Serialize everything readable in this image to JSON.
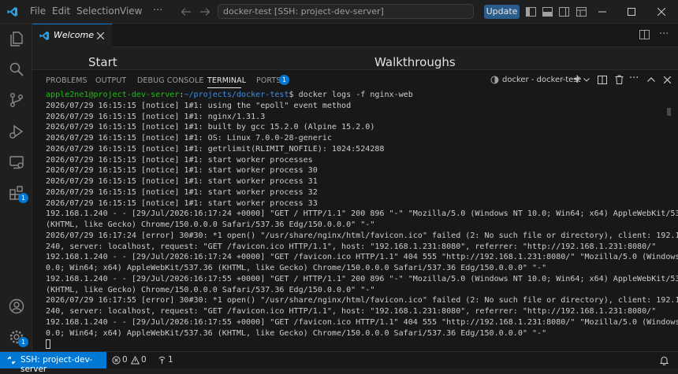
{
  "titlebar": {
    "menu": [
      "File",
      "Edit",
      "Selection",
      "View"
    ],
    "command_center": "docker-test [SSH: project-dev-server]",
    "update_label": "Update"
  },
  "activity": {
    "extensions_badge": "1",
    "settings_badge": "1"
  },
  "editor": {
    "tab_label": "Welcome",
    "start_heading": "Start",
    "walkthroughs_heading": "Walkthroughs"
  },
  "panel": {
    "tabs": [
      "PROBLEMS",
      "OUTPUT",
      "DEBUG CONSOLE",
      "TERMINAL",
      "PORTS"
    ],
    "ports_badge": "1",
    "terminal_name": "docker - docker-test"
  },
  "terminal": {
    "prompt_user": "apple2ne1@project-dev-server",
    "prompt_sep": ":",
    "prompt_path": "~/projects/docker-test",
    "prompt_cmd": "$ docker logs -f nginx-web",
    "lines": [
      "2026/07/29 16:15:15 [notice] 1#1: using the \"epoll\" event method",
      "2026/07/29 16:15:15 [notice] 1#1: nginx/1.31.3",
      "2026/07/29 16:15:15 [notice] 1#1: built by gcc 15.2.0 (Alpine 15.2.0)",
      "2026/07/29 16:15:15 [notice] 1#1: OS: Linux 7.0.0-28-generic",
      "2026/07/29 16:15:15 [notice] 1#1: getrlimit(RLIMIT_NOFILE): 1024:524288",
      "2026/07/29 16:15:15 [notice] 1#1: start worker processes",
      "2026/07/29 16:15:15 [notice] 1#1: start worker process 30",
      "2026/07/29 16:15:15 [notice] 1#1: start worker process 31",
      "2026/07/29 16:15:15 [notice] 1#1: start worker process 32",
      "2026/07/29 16:15:15 [notice] 1#1: start worker process 33",
      "192.168.1.240 - - [29/Jul/2026:16:17:24 +0000] \"GET / HTTP/1.1\" 200 896 \"-\" \"Mozilla/5.0 (Windows NT 10.0; Win64; x64) AppleWebKit/537.36",
      "(KHTML, like Gecko) Chrome/150.0.0.0 Safari/537.36 Edg/150.0.0.0\" \"-\"",
      "2026/07/29 16:17:24 [error] 30#30: *1 open() \"/usr/share/nginx/html/favicon.ico\" failed (2: No such file or directory), client: 192.168.1.",
      "240, server: localhost, request: \"GET /favicon.ico HTTP/1.1\", host: \"192.168.1.231:8080\", referrer: \"http://192.168.1.231:8080/\"",
      "192.168.1.240 - - [29/Jul/2026:16:17:24 +0000] \"GET /favicon.ico HTTP/1.1\" 404 555 \"http://192.168.1.231:8080/\" \"Mozilla/5.0 (Windows NT 1",
      "0.0; Win64; x64) AppleWebKit/537.36 (KHTML, like Gecko) Chrome/150.0.0.0 Safari/537.36 Edg/150.0.0.0\" \"-\"",
      "192.168.1.240 - - [29/Jul/2026:16:17:55 +0000] \"GET / HTTP/1.1\" 200 896 \"-\" \"Mozilla/5.0 (Windows NT 10.0; Win64; x64) AppleWebKit/537.36",
      "(KHTML, like Gecko) Chrome/150.0.0.0 Safari/537.36 Edg/150.0.0.0\" \"-\"",
      "2026/07/29 16:17:55 [error] 30#30: *1 open() \"/usr/share/nginx/html/favicon.ico\" failed (2: No such file or directory), client: 192.168.1.",
      "240, server: localhost, request: \"GET /favicon.ico HTTP/1.1\", host: \"192.168.1.231:8080\", referrer: \"http://192.168.1.231:8080/\"",
      "192.168.1.240 - - [29/Jul/2026:16:17:55 +0000] \"GET /favicon.ico HTTP/1.1\" 404 555 \"http://192.168.1.231:8080/\" \"Mozilla/5.0 (Windows NT 1",
      "0.0; Win64; x64) AppleWebKit/537.36 (KHTML, like Gecko) Chrome/150.0.0.0 Safari/537.36 Edg/150.0.0.0\" \"-\""
    ]
  },
  "statusbar": {
    "remote_label": "SSH: project-dev-server",
    "errors": "0",
    "warnings": "0",
    "ports": "1"
  },
  "colors": {
    "accent": "#0078d4",
    "prompt_user": "#16c60c",
    "prompt_path": "#3b8eea"
  }
}
